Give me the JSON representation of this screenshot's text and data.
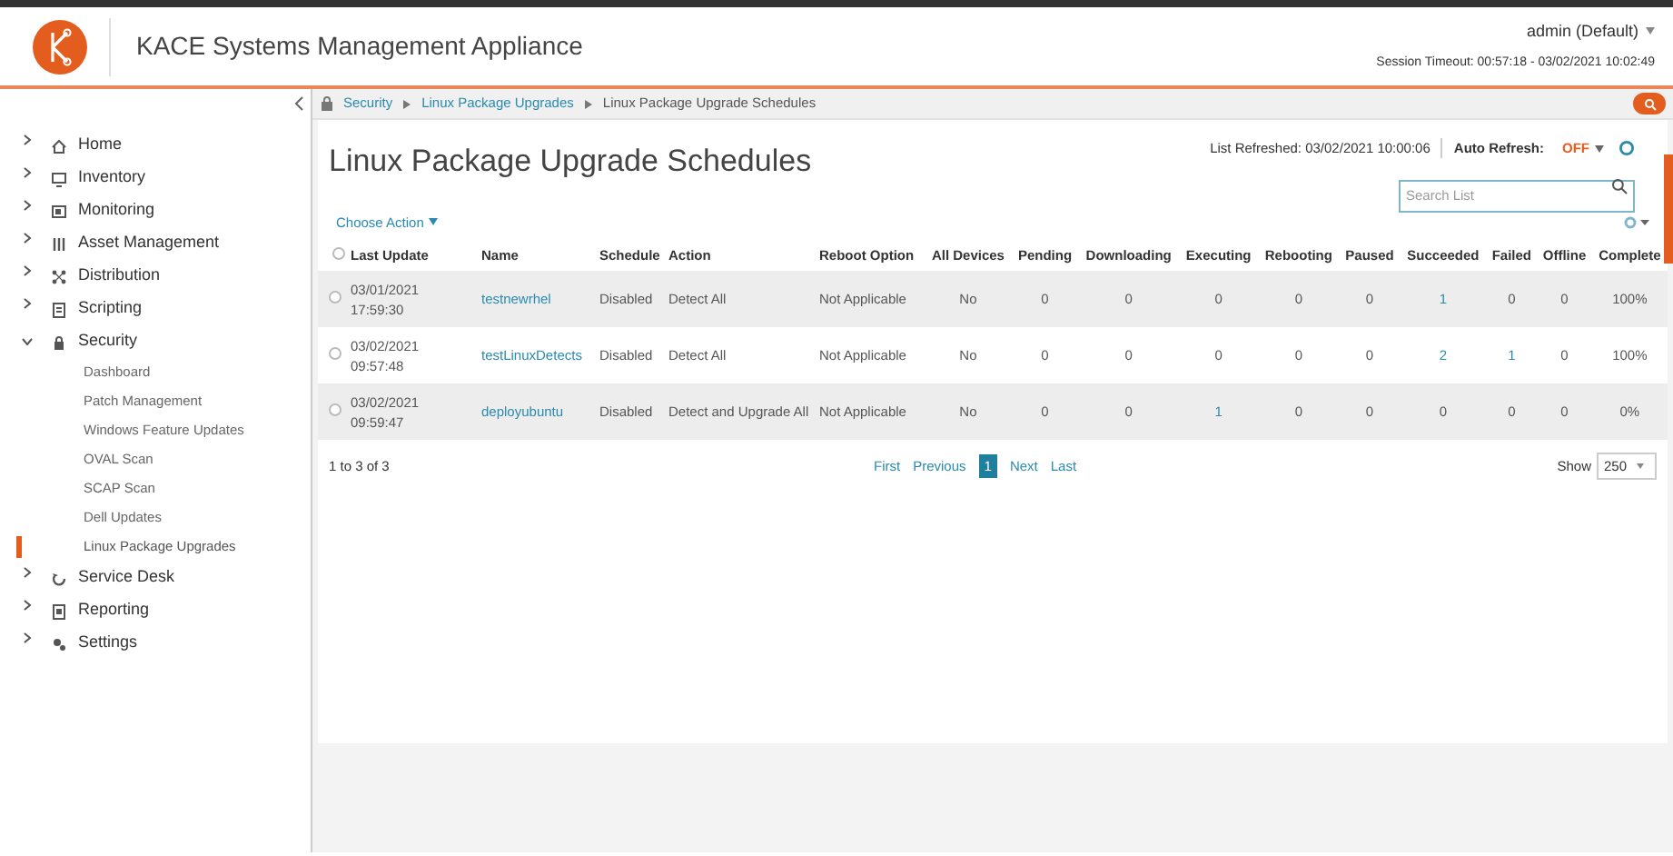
{
  "header": {
    "title": "KACE Systems Management Appliance",
    "user": "admin (Default)",
    "session": "Session Timeout: 00:57:18 - 03/02/2021 10:02:49"
  },
  "breadcrumb": [
    "Security",
    "Linux Package Upgrades",
    "Linux Package Upgrade Schedules"
  ],
  "sidebar": {
    "items": [
      {
        "label": "Home",
        "expanded": false
      },
      {
        "label": "Inventory",
        "expanded": false
      },
      {
        "label": "Monitoring",
        "expanded": false
      },
      {
        "label": "Asset Management",
        "expanded": false
      },
      {
        "label": "Distribution",
        "expanded": false
      },
      {
        "label": "Scripting",
        "expanded": false
      },
      {
        "label": "Security",
        "expanded": true,
        "children": [
          {
            "label": "Dashboard",
            "selected": false
          },
          {
            "label": "Patch Management",
            "selected": false
          },
          {
            "label": "Windows Feature Updates",
            "selected": false
          },
          {
            "label": "OVAL Scan",
            "selected": false
          },
          {
            "label": "SCAP Scan",
            "selected": false
          },
          {
            "label": "Dell Updates",
            "selected": false
          },
          {
            "label": "Linux Package Upgrades",
            "selected": true
          }
        ]
      },
      {
        "label": "Service Desk",
        "expanded": false
      },
      {
        "label": "Reporting",
        "expanded": false
      },
      {
        "label": "Settings",
        "expanded": false
      }
    ]
  },
  "page": {
    "title": "Linux Package Upgrade Schedules",
    "list_refreshed": "List Refreshed: 03/02/2021 10:00:06",
    "auto_refresh_label": "Auto Refresh:",
    "auto_refresh_value": "OFF",
    "search": {
      "placeholder": "Search List"
    },
    "choose_action": "Choose Action"
  },
  "table": {
    "select_all_checked": false,
    "columns": [
      "Last Update",
      "Name",
      "Schedule",
      "Action",
      "Reboot Option",
      "All Devices",
      "Pending",
      "Downloading",
      "Executing",
      "Rebooting",
      "Paused",
      "Succeeded",
      "Failed",
      "Offline",
      "Complete"
    ],
    "rows": [
      {
        "checked": false,
        "cells": [
          {
            "text": "03/01/2021 17:59:30",
            "link": false
          },
          {
            "text": "testnewrhel",
            "link": true
          },
          {
            "text": "Disabled",
            "link": false
          },
          {
            "text": "Detect All",
            "link": false
          },
          {
            "text": "Not Applicable",
            "link": false
          },
          {
            "text": "No",
            "link": false
          },
          {
            "text": "0",
            "link": false
          },
          {
            "text": "0",
            "link": false
          },
          {
            "text": "0",
            "link": false
          },
          {
            "text": "0",
            "link": false
          },
          {
            "text": "0",
            "link": false
          },
          {
            "text": "1",
            "link": true
          },
          {
            "text": "0",
            "link": false
          },
          {
            "text": "0",
            "link": false
          },
          {
            "text": "100%",
            "link": false
          }
        ]
      },
      {
        "checked": false,
        "cells": [
          {
            "text": "03/02/2021 09:57:48",
            "link": false
          },
          {
            "text": "testLinuxDetects",
            "link": true
          },
          {
            "text": "Disabled",
            "link": false
          },
          {
            "text": "Detect All",
            "link": false
          },
          {
            "text": "Not Applicable",
            "link": false
          },
          {
            "text": "No",
            "link": false
          },
          {
            "text": "0",
            "link": false
          },
          {
            "text": "0",
            "link": false
          },
          {
            "text": "0",
            "link": false
          },
          {
            "text": "0",
            "link": false
          },
          {
            "text": "0",
            "link": false
          },
          {
            "text": "2",
            "link": true
          },
          {
            "text": "1",
            "link": true
          },
          {
            "text": "0",
            "link": false
          },
          {
            "text": "100%",
            "link": false
          }
        ]
      },
      {
        "checked": false,
        "cells": [
          {
            "text": "03/02/2021 09:59:47",
            "link": false
          },
          {
            "text": "deployubuntu",
            "link": true
          },
          {
            "text": "Disabled",
            "link": false
          },
          {
            "text": "Detect and Upgrade All",
            "link": false
          },
          {
            "text": "Not Applicable",
            "link": false
          },
          {
            "text": "No",
            "link": false
          },
          {
            "text": "0",
            "link": false
          },
          {
            "text": "0",
            "link": false
          },
          {
            "text": "1",
            "link": true
          },
          {
            "text": "0",
            "link": false
          },
          {
            "text": "0",
            "link": false
          },
          {
            "text": "0",
            "link": false
          },
          {
            "text": "0",
            "link": false
          },
          {
            "text": "0",
            "link": false
          },
          {
            "text": "0%",
            "link": false
          }
        ]
      }
    ]
  },
  "footer": {
    "count": "1 to 3 of 3",
    "pages": [
      {
        "label": "First",
        "selected": false
      },
      {
        "label": "Previous",
        "selected": false
      },
      {
        "label": "1",
        "selected": true
      },
      {
        "label": "Next",
        "selected": false
      },
      {
        "label": "Last",
        "selected": false
      }
    ],
    "show_label": "Show",
    "show_value": "250"
  }
}
